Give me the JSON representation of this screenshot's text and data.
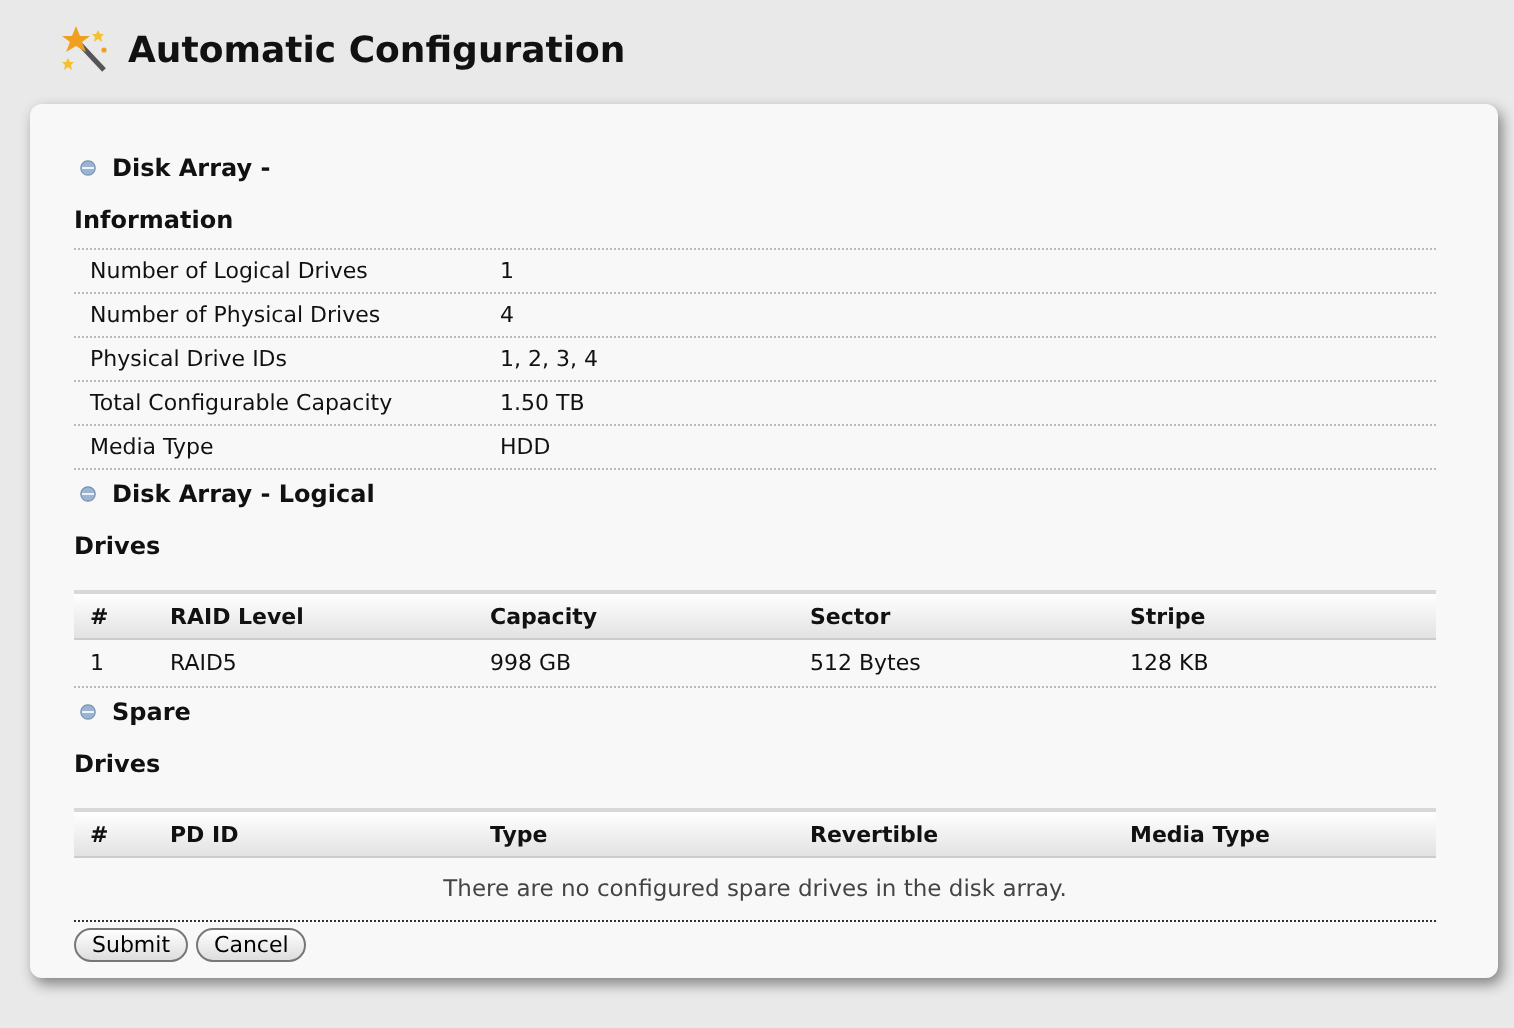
{
  "title": "Automatic Configuration",
  "sections": [
    {
      "kind": "info",
      "heading": "Disk Array -",
      "subheading": "Information",
      "rows": [
        {
          "label": "Number of Logical Drives",
          "value": "1"
        },
        {
          "label": "Number of Physical Drives",
          "value": "4"
        },
        {
          "label": "Physical Drive IDs",
          "value": "1, 2, 3, 4"
        },
        {
          "label": "Total Configurable Capacity",
          "value": "1.50 TB"
        },
        {
          "label": "Media Type",
          "value": "HDD"
        }
      ]
    },
    {
      "kind": "table",
      "heading": "Disk Array - Logical",
      "subheading": "Drives",
      "columns": [
        "#",
        "RAID Level",
        "Capacity",
        "Sector",
        "Stripe"
      ],
      "rows": [
        [
          "1",
          "RAID5",
          "998 GB",
          "512 Bytes",
          "128 KB"
        ]
      ]
    },
    {
      "kind": "table",
      "heading": "Spare",
      "subheading": "Drives",
      "columns": [
        "#",
        "PD ID",
        "Type",
        "Revertible",
        "Media Type"
      ],
      "empty_message": "There are no configured spare drives in the disk array."
    }
  ],
  "buttons": [
    "Submit",
    "Cancel"
  ]
}
